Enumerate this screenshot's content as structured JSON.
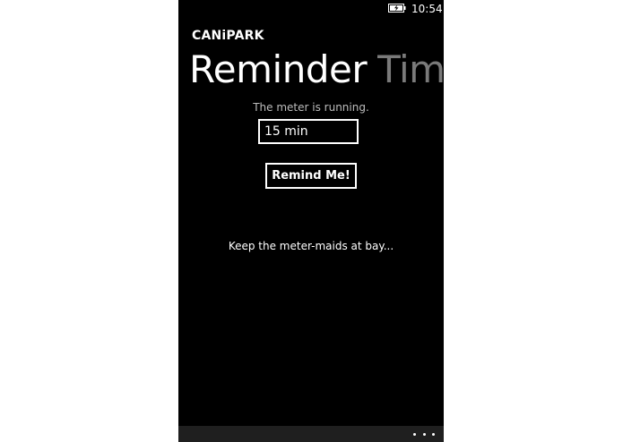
{
  "status_bar": {
    "icons": [
      "battery-charging-icon"
    ],
    "time": "10:54"
  },
  "app": {
    "title": "CANiPARK"
  },
  "pivot": {
    "items": [
      {
        "label": "Reminder",
        "active": true
      },
      {
        "label": "Time",
        "active": false
      }
    ]
  },
  "main": {
    "status_text": "The meter is running.",
    "duration_value": "15 min",
    "remind_button_label": "Remind Me!",
    "tagline": "Keep the meter-maids at bay..."
  },
  "app_bar": {
    "more_icon": "ellipsis-icon"
  },
  "colors": {
    "background": "#000000",
    "text": "#ffffff",
    "muted_text": "#7a7a7a",
    "app_bar": "#1f1f1f"
  }
}
